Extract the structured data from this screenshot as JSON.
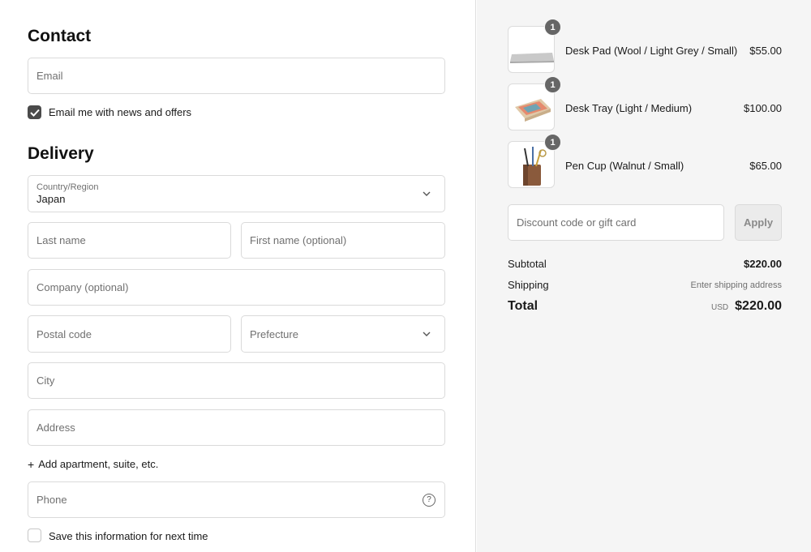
{
  "contact": {
    "heading": "Contact",
    "email_placeholder": "Email",
    "news_label": "Email me with news and offers",
    "news_checked": true
  },
  "delivery": {
    "heading": "Delivery",
    "country_label": "Country/Region",
    "country_value": "Japan",
    "last_name_placeholder": "Last name",
    "first_name_placeholder": "First name (optional)",
    "company_placeholder": "Company (optional)",
    "postal_placeholder": "Postal code",
    "prefecture_placeholder": "Prefecture",
    "city_placeholder": "City",
    "address_placeholder": "Address",
    "add_apartment_label": "Add apartment, suite, etc.",
    "phone_placeholder": "Phone",
    "save_info_label": "Save this information for next time",
    "save_info_checked": false
  },
  "cart": {
    "items": [
      {
        "name": "Desk Pad (Wool / Light Grey / Small)",
        "price": "$55.00",
        "qty": "1",
        "icon": "desk-pad-thumbnail"
      },
      {
        "name": "Desk Tray (Light / Medium)",
        "price": "$100.00",
        "qty": "1",
        "icon": "desk-tray-thumbnail"
      },
      {
        "name": "Pen Cup (Walnut / Small)",
        "price": "$65.00",
        "qty": "1",
        "icon": "pen-cup-thumbnail"
      }
    ],
    "discount_placeholder": "Discount code or gift card",
    "apply_label": "Apply",
    "subtotal_label": "Subtotal",
    "subtotal_value": "$220.00",
    "shipping_label": "Shipping",
    "shipping_value": "Enter shipping address",
    "total_label": "Total",
    "total_currency": "USD",
    "total_value": "$220.00"
  },
  "colors": {
    "checkbox_checked": "#4a4a4a",
    "summary_background": "#f5f5f5",
    "badge": "#666666"
  }
}
